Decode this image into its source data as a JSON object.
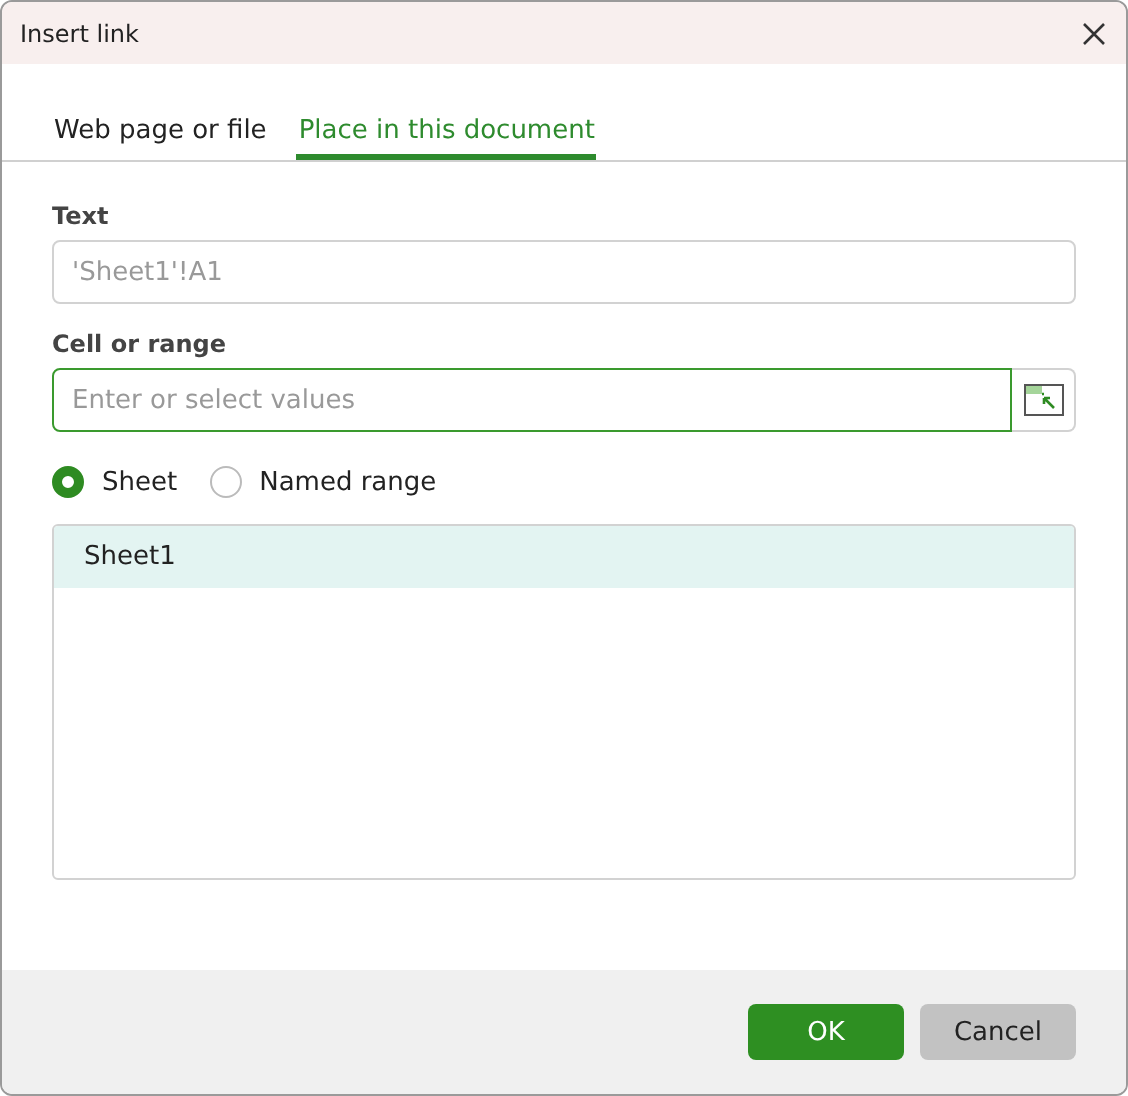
{
  "window": {
    "title": "Insert link"
  },
  "tabs": [
    {
      "label": "Web page or file",
      "selected": false
    },
    {
      "label": "Place in this document",
      "selected": true
    }
  ],
  "text_field": {
    "label": "Text",
    "placeholder": "'Sheet1'!A1"
  },
  "range_field": {
    "label": "Cell or range",
    "placeholder": "Enter or select values",
    "focused": true
  },
  "scope_options": [
    {
      "label": "Sheet",
      "selected": true
    },
    {
      "label": "Named range",
      "selected": false
    }
  ],
  "list_items": [
    {
      "label": "Sheet1",
      "selected": true
    }
  ],
  "buttons": [
    {
      "label": "OK",
      "kind": "primary"
    },
    {
      "label": "Cancel",
      "kind": "secondary"
    }
  ]
}
